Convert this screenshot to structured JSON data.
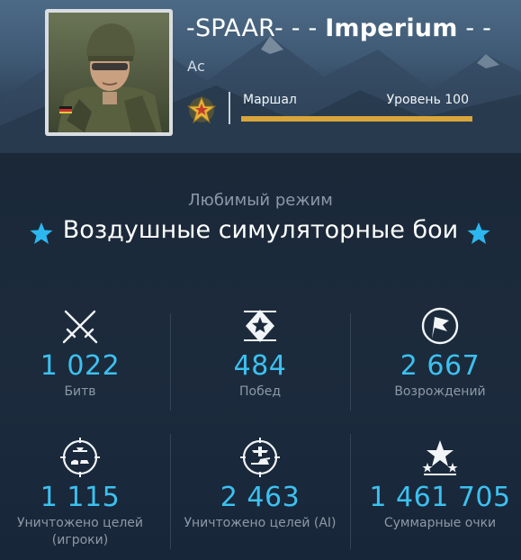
{
  "player": {
    "nick_prefix": "-SPAAR- - -",
    "nick_clan": "Imperium",
    "nick_suffix": "- -",
    "title": "Ас",
    "rank_name": "Маршал",
    "level_label": "Уровень 100",
    "level_progress": 1.0,
    "rank_icon": "gold-star-rank-icon",
    "avatar": "soldier-portrait"
  },
  "favorite": {
    "label": "Любимый режим",
    "mode": "Воздушные симуляторные бои",
    "star_icon": "star-icon"
  },
  "stats": [
    {
      "icon": "crossed-swords-icon",
      "value": "1 022",
      "label": "Битв"
    },
    {
      "icon": "victory-star-icon",
      "value": "484",
      "label": "Побед"
    },
    {
      "icon": "flag-respawn-icon",
      "value": "2 667",
      "label": "Возрождений"
    },
    {
      "icon": "air-targets-icon",
      "value": "1 115",
      "label": "Уничтожено целей (игроки)"
    },
    {
      "icon": "ground-targets-icon",
      "value": "2 463",
      "label": "Уничтожено целей (AI)"
    },
    {
      "icon": "score-stars-icon",
      "value": "1 461 705",
      "label": "Суммарные очки"
    }
  ],
  "colors": {
    "accent_value": "#3cc1f0",
    "progress": "#d9a63a",
    "star": "#2bb8f0"
  }
}
